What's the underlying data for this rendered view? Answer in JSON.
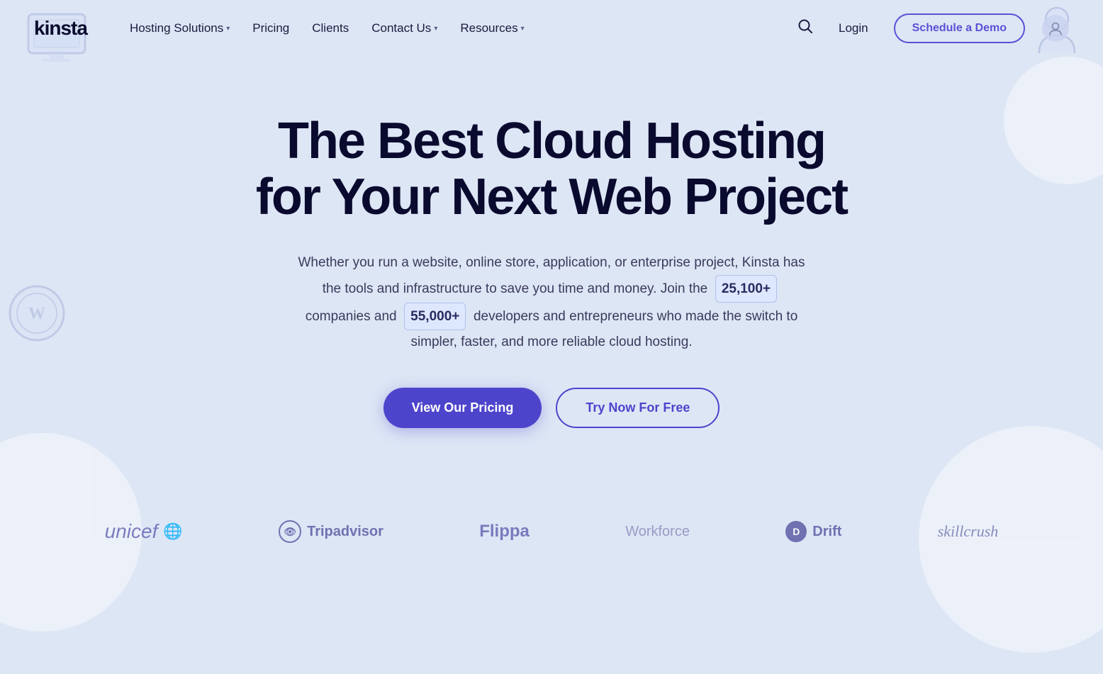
{
  "meta": {
    "bg_color": "#dde6f5"
  },
  "logo": {
    "text": "KINStA"
  },
  "nav": {
    "items": [
      {
        "label": "Hosting Solutions",
        "has_dropdown": true
      },
      {
        "label": "Pricing",
        "has_dropdown": false
      },
      {
        "label": "Clients",
        "has_dropdown": false
      },
      {
        "label": "Contact Us",
        "has_dropdown": true
      },
      {
        "label": "Resources",
        "has_dropdown": true
      }
    ],
    "login_label": "Login",
    "schedule_label": "Schedule a Demo"
  },
  "hero": {
    "title_line1": "The Best Cloud Hosting",
    "title_line2": "for Your Next Web Project",
    "subtitle_before": "Whether you run a website, online store, application, or enterprise project, Kinsta has the tools and infrastructure to save you time and money. Join the",
    "badge1": "25,100+",
    "subtitle_mid": "companies and",
    "badge2": "55,000+",
    "subtitle_after": "developers and entrepreneurs who made the switch to simpler, faster, and more reliable cloud hosting.",
    "cta_primary": "View Our Pricing",
    "cta_secondary": "Try Now For Free"
  },
  "logos": [
    {
      "name": "unicef",
      "text": "unicef",
      "icon": "🌐"
    },
    {
      "name": "tripadvisor",
      "text": "Tripadvisor",
      "icon": "👁"
    },
    {
      "name": "flippa",
      "text": "Flippa",
      "icon": ""
    },
    {
      "name": "workforce",
      "text": "Workforce",
      "icon": ""
    },
    {
      "name": "drift",
      "text": "Drift",
      "icon": "🎯"
    },
    {
      "name": "skillcrush",
      "text": "skillcrush",
      "icon": ""
    }
  ]
}
